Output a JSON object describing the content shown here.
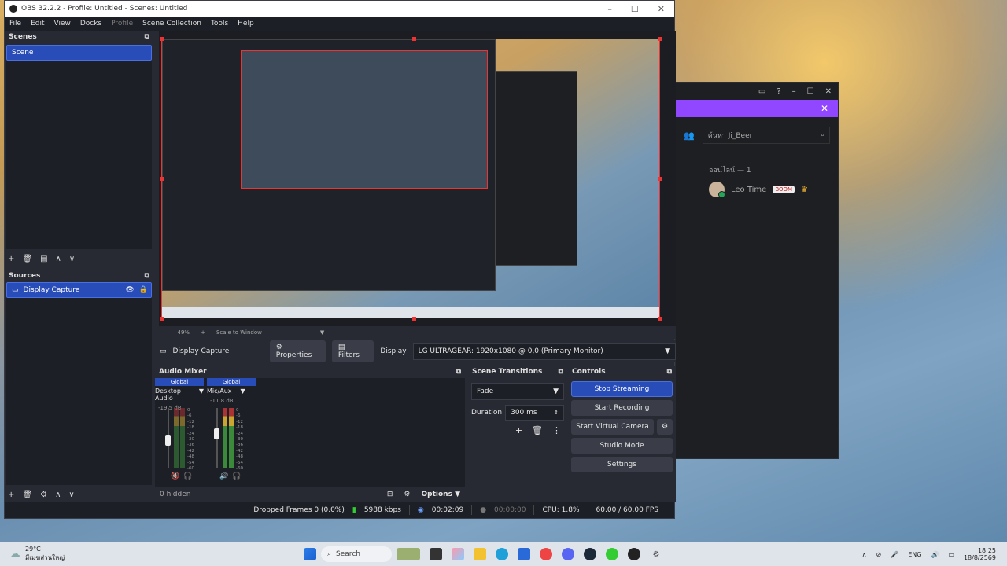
{
  "desktop_bg": "#6a8fb0",
  "discord": {
    "close": "✕",
    "search_placeholder": "ค้นหา Ji_Beer",
    "online_header": "ออนไลน์ — 1",
    "member_name": "Leo Time",
    "member_badge": "BOOM"
  },
  "obs": {
    "title": "OBS 32.2.2 - Profile: Untitled - Scenes: Untitled",
    "menu": [
      "File",
      "Edit",
      "View",
      "Docks",
      "Profile",
      "Scene Collection",
      "Tools",
      "Help"
    ],
    "scenes": {
      "header": "Scenes",
      "items": [
        "Scene"
      ]
    },
    "sources": {
      "header": "Sources",
      "items": [
        "Display Capture"
      ]
    },
    "preview": {
      "zoom": "49%",
      "scale_mode": "Scale to Window"
    },
    "context": {
      "source_name": "Display Capture",
      "properties": "Properties",
      "filters": "Filters",
      "display_label": "Display",
      "display_value": "LG ULTRAGEAR: 1920x1080 @ 0,0 (Primary Monitor)"
    },
    "mixer": {
      "header": "Audio Mixer",
      "channels": [
        {
          "scope": "Global",
          "name": "Desktop Audio",
          "db": "-19.5 dB",
          "level": 0.45
        },
        {
          "scope": "Global",
          "name": "Mic/Aux",
          "db": "-11.8 dB",
          "level": 0.7
        }
      ],
      "ticks": [
        "0",
        "-6",
        "-12",
        "-18",
        "-24",
        "-30",
        "-36",
        "-42",
        "-48",
        "-54",
        "-60"
      ],
      "hidden": "0 hidden",
      "options": "Options"
    },
    "transitions": {
      "header": "Scene Transitions",
      "type": "Fade",
      "duration_label": "Duration",
      "duration_value": "300 ms"
    },
    "controls": {
      "header": "Controls",
      "stop_streaming": "Stop Streaming",
      "start_recording": "Start Recording",
      "start_virtual_camera": "Start Virtual Camera",
      "studio_mode": "Studio Mode",
      "settings": "Settings"
    },
    "status": {
      "dropped": "Dropped Frames 0 (0.0%)",
      "bitrate": "5988 kbps",
      "stream_time": "00:02:09",
      "rec_time": "00:00:00",
      "cpu": "CPU: 1.8%",
      "fps": "60.00 / 60.00 FPS"
    }
  },
  "taskbar": {
    "temp": "29°C",
    "weather": "มีเมฆส่วนใหญ่",
    "search": "Search",
    "lang": "ENG",
    "time": "18:25",
    "date": "18/8/2569"
  }
}
